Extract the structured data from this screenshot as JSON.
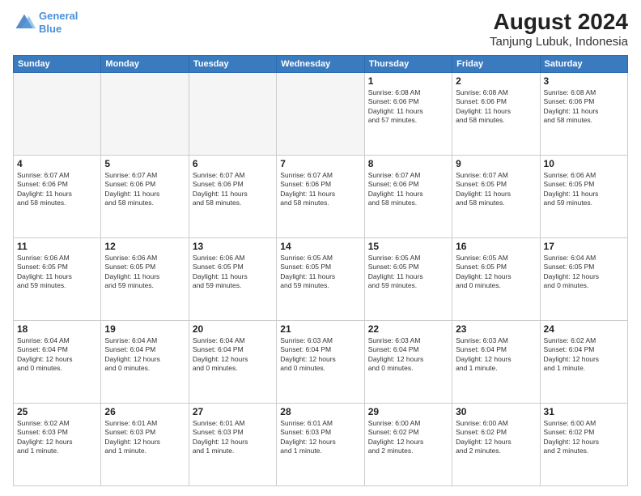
{
  "header": {
    "logo_line1": "General",
    "logo_line2": "Blue",
    "title": "August 2024",
    "subtitle": "Tanjung Lubuk, Indonesia"
  },
  "weekdays": [
    "Sunday",
    "Monday",
    "Tuesday",
    "Wednesday",
    "Thursday",
    "Friday",
    "Saturday"
  ],
  "weeks": [
    [
      {
        "day": "",
        "info": "",
        "empty": true
      },
      {
        "day": "",
        "info": "",
        "empty": true
      },
      {
        "day": "",
        "info": "",
        "empty": true
      },
      {
        "day": "",
        "info": "",
        "empty": true
      },
      {
        "day": "1",
        "info": "Sunrise: 6:08 AM\nSunset: 6:06 PM\nDaylight: 11 hours\nand 57 minutes."
      },
      {
        "day": "2",
        "info": "Sunrise: 6:08 AM\nSunset: 6:06 PM\nDaylight: 11 hours\nand 58 minutes."
      },
      {
        "day": "3",
        "info": "Sunrise: 6:08 AM\nSunset: 6:06 PM\nDaylight: 11 hours\nand 58 minutes."
      }
    ],
    [
      {
        "day": "4",
        "info": "Sunrise: 6:07 AM\nSunset: 6:06 PM\nDaylight: 11 hours\nand 58 minutes."
      },
      {
        "day": "5",
        "info": "Sunrise: 6:07 AM\nSunset: 6:06 PM\nDaylight: 11 hours\nand 58 minutes."
      },
      {
        "day": "6",
        "info": "Sunrise: 6:07 AM\nSunset: 6:06 PM\nDaylight: 11 hours\nand 58 minutes."
      },
      {
        "day": "7",
        "info": "Sunrise: 6:07 AM\nSunset: 6:06 PM\nDaylight: 11 hours\nand 58 minutes."
      },
      {
        "day": "8",
        "info": "Sunrise: 6:07 AM\nSunset: 6:06 PM\nDaylight: 11 hours\nand 58 minutes."
      },
      {
        "day": "9",
        "info": "Sunrise: 6:07 AM\nSunset: 6:05 PM\nDaylight: 11 hours\nand 58 minutes."
      },
      {
        "day": "10",
        "info": "Sunrise: 6:06 AM\nSunset: 6:05 PM\nDaylight: 11 hours\nand 59 minutes."
      }
    ],
    [
      {
        "day": "11",
        "info": "Sunrise: 6:06 AM\nSunset: 6:05 PM\nDaylight: 11 hours\nand 59 minutes."
      },
      {
        "day": "12",
        "info": "Sunrise: 6:06 AM\nSunset: 6:05 PM\nDaylight: 11 hours\nand 59 minutes."
      },
      {
        "day": "13",
        "info": "Sunrise: 6:06 AM\nSunset: 6:05 PM\nDaylight: 11 hours\nand 59 minutes."
      },
      {
        "day": "14",
        "info": "Sunrise: 6:05 AM\nSunset: 6:05 PM\nDaylight: 11 hours\nand 59 minutes."
      },
      {
        "day": "15",
        "info": "Sunrise: 6:05 AM\nSunset: 6:05 PM\nDaylight: 11 hours\nand 59 minutes."
      },
      {
        "day": "16",
        "info": "Sunrise: 6:05 AM\nSunset: 6:05 PM\nDaylight: 12 hours\nand 0 minutes."
      },
      {
        "day": "17",
        "info": "Sunrise: 6:04 AM\nSunset: 6:05 PM\nDaylight: 12 hours\nand 0 minutes."
      }
    ],
    [
      {
        "day": "18",
        "info": "Sunrise: 6:04 AM\nSunset: 6:04 PM\nDaylight: 12 hours\nand 0 minutes."
      },
      {
        "day": "19",
        "info": "Sunrise: 6:04 AM\nSunset: 6:04 PM\nDaylight: 12 hours\nand 0 minutes."
      },
      {
        "day": "20",
        "info": "Sunrise: 6:04 AM\nSunset: 6:04 PM\nDaylight: 12 hours\nand 0 minutes."
      },
      {
        "day": "21",
        "info": "Sunrise: 6:03 AM\nSunset: 6:04 PM\nDaylight: 12 hours\nand 0 minutes."
      },
      {
        "day": "22",
        "info": "Sunrise: 6:03 AM\nSunset: 6:04 PM\nDaylight: 12 hours\nand 0 minutes."
      },
      {
        "day": "23",
        "info": "Sunrise: 6:03 AM\nSunset: 6:04 PM\nDaylight: 12 hours\nand 1 minute."
      },
      {
        "day": "24",
        "info": "Sunrise: 6:02 AM\nSunset: 6:04 PM\nDaylight: 12 hours\nand 1 minute."
      }
    ],
    [
      {
        "day": "25",
        "info": "Sunrise: 6:02 AM\nSunset: 6:03 PM\nDaylight: 12 hours\nand 1 minute."
      },
      {
        "day": "26",
        "info": "Sunrise: 6:01 AM\nSunset: 6:03 PM\nDaylight: 12 hours\nand 1 minute."
      },
      {
        "day": "27",
        "info": "Sunrise: 6:01 AM\nSunset: 6:03 PM\nDaylight: 12 hours\nand 1 minute."
      },
      {
        "day": "28",
        "info": "Sunrise: 6:01 AM\nSunset: 6:03 PM\nDaylight: 12 hours\nand 1 minute."
      },
      {
        "day": "29",
        "info": "Sunrise: 6:00 AM\nSunset: 6:02 PM\nDaylight: 12 hours\nand 2 minutes."
      },
      {
        "day": "30",
        "info": "Sunrise: 6:00 AM\nSunset: 6:02 PM\nDaylight: 12 hours\nand 2 minutes."
      },
      {
        "day": "31",
        "info": "Sunrise: 6:00 AM\nSunset: 6:02 PM\nDaylight: 12 hours\nand 2 minutes."
      }
    ]
  ]
}
